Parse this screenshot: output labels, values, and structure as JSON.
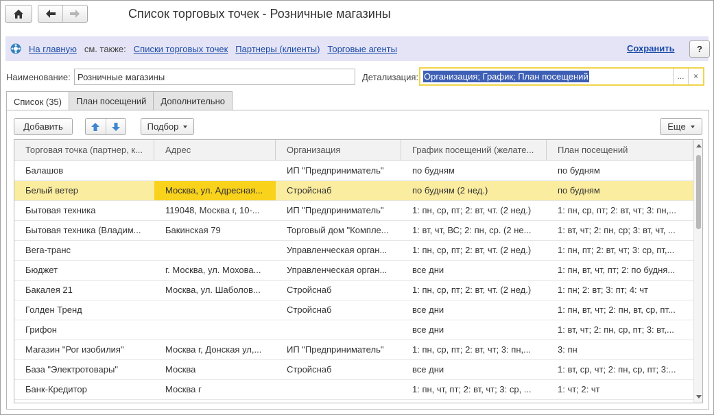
{
  "window": {
    "title": "Список торговых точек - Розничные магазины",
    "home_icon": "home-icon",
    "back_icon": "arrow-left-icon",
    "forward_icon": "arrow-right-icon"
  },
  "infobar": {
    "home_link": "На главную",
    "see_also": "см. также:",
    "links": [
      "Списки торговых точек",
      "Партнеры (клиенты)",
      "Торговые агенты"
    ],
    "save": "Сохранить",
    "help": "?"
  },
  "form": {
    "name_label": "Наименование:",
    "name_value": "Розничные магазины",
    "detail_label": "Детализация:",
    "detail_value": "Организация; График; План посещений",
    "detail_dots": "...",
    "detail_clear": "×"
  },
  "tabs": [
    {
      "label": "Список (35)",
      "active": true
    },
    {
      "label": "План посещений",
      "active": false
    },
    {
      "label": "Дополнительно",
      "active": false
    }
  ],
  "toolbar": {
    "add": "Добавить",
    "pick": "Подбор",
    "more": "Еще"
  },
  "table": {
    "columns": [
      "Торговая точка (партнер, к...",
      "Адрес",
      "Организация",
      "График посещений (желате...",
      "План посещений"
    ],
    "rows": [
      [
        "Балашов",
        "",
        "ИП \"Предприниматель\"",
        "по будням",
        "по будням"
      ],
      [
        "Белый ветер",
        "Москва, ул. Адресная...",
        "Стройснаб",
        "по будням (2 нед.)",
        "по будням"
      ],
      [
        "Бытовая техника",
        "119048, Москва г, 10-...",
        "ИП \"Предприниматель\"",
        "1: пн, ср, пт; 2: вт, чт. (2 нед.)",
        "1: пн, ср, пт; 2: вт, чт; 3: пн,..."
      ],
      [
        "Бытовая техника (Владим...",
        "Бакинская 79",
        "Торговый дом \"Компле...",
        "1: вт, чт, ВС; 2: пн, ср. (2 не...",
        "1: вт, чт; 2: пн, ср; 3: вт, чт, ..."
      ],
      [
        "Вега-транс",
        "",
        "Управленческая орган...",
        "1: пн, ср, пт; 2: вт, чт. (2 нед.)",
        "1: пн, пт; 2: вт, чт; 3: ср, пт,..."
      ],
      [
        "Бюджет",
        "г. Москва, ул. Мохова...",
        "Управленческая орган...",
        "все дни",
        "1: пн, вт, чт, пт; 2: по будня..."
      ],
      [
        "Бакалея 21",
        "Москва, ул. Шаболов...",
        "Стройснаб",
        "1: пн, ср, пт; 2: вт, чт. (2 нед.)",
        "1: пн; 2: вт; 3: пт; 4: чт"
      ],
      [
        "Голден Тренд",
        "",
        "Стройснаб",
        "все дни",
        "1: пн, вт, чт; 2: пн, вт, ср, пт..."
      ],
      [
        "Грифон",
        "",
        "",
        "все дни",
        "1: вт, чт; 2: пн, ср, пт; 3: вт,..."
      ],
      [
        "Магазин \"Рог изобилия\"",
        "Москва г, Донская ул,...",
        "ИП \"Предприниматель\"",
        "1: пн, ср, пт; 2: вт, чт; 3: пн,...",
        "3: пн"
      ],
      [
        "База \"Электротовары\"",
        "Москва",
        "Стройснаб",
        "все дни",
        "1: вт, ср, чт; 2: пн, ср, пт; 3:..."
      ],
      [
        "Банк-Кредитор",
        "Москва г",
        "",
        "1: пн, чт, пт; 2: вт, чт; 3: ср, ...",
        "1: чт; 2: чт"
      ]
    ],
    "selected_row": 1
  }
}
